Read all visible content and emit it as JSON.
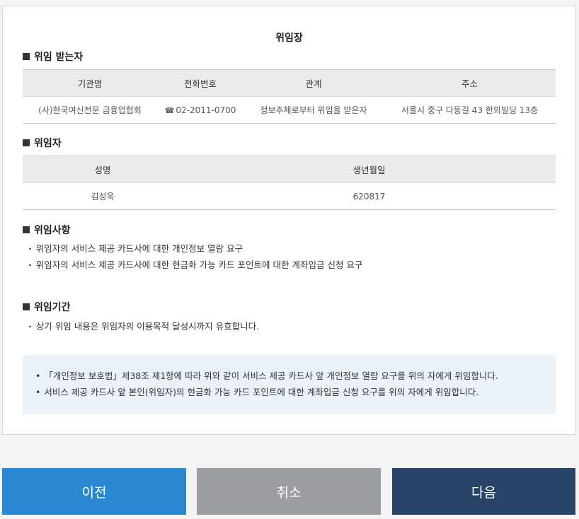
{
  "document": {
    "title": "위임장"
  },
  "delegatee": {
    "section_title": "위임 받는자",
    "headers": [
      "기관명",
      "전화번호",
      "관계",
      "주소"
    ],
    "row": {
      "org": "(사)한국여신전문 금융업협회",
      "phone_icon": "☎",
      "phone": "02-2011-0700",
      "relation": "정보주체로부터 위임을 받은자",
      "address": "서울시 중구 다동길 43 한외빌딩 13층"
    }
  },
  "delegator": {
    "section_title": "위임자",
    "headers": [
      "성명",
      "생년월일"
    ],
    "row": {
      "name": "김성욱",
      "birth": "620817"
    }
  },
  "matters": {
    "section_title": "위임사항",
    "items": [
      "위임자의 서비스 제공 카드사에 대한 개인정보 열람 요구",
      "위임자의 서비스 제공 카드사에 대한 현금화 가능 카드 포인트에 대한 계좌입금 신청 요구"
    ]
  },
  "period": {
    "section_title": "위임기간",
    "items": [
      "상기 위임 내용은 위임자의 이용목적 달성시까지 유효합니다."
    ]
  },
  "notice": {
    "items": [
      "「개인정보 보호법」제38조 제1항에 따라 위와 같이 서비스 제공 카드사 앞 개인정보 열람 요구를 위의 자에게 위임합니다.",
      "서비스 제공 카드사 앞 본인(위임자)의 현금화 가능 카드 포인트에 대한 계좌입금 신청 요구를 위의 자에게 위임합니다."
    ]
  },
  "buttons": {
    "prev": "이전",
    "cancel": "취소",
    "next": "다음"
  },
  "colors": {
    "prev": "#2a88d3",
    "cancel": "#9a9ea2",
    "next": "#274468",
    "notice_bg": "#ebf1f8"
  }
}
